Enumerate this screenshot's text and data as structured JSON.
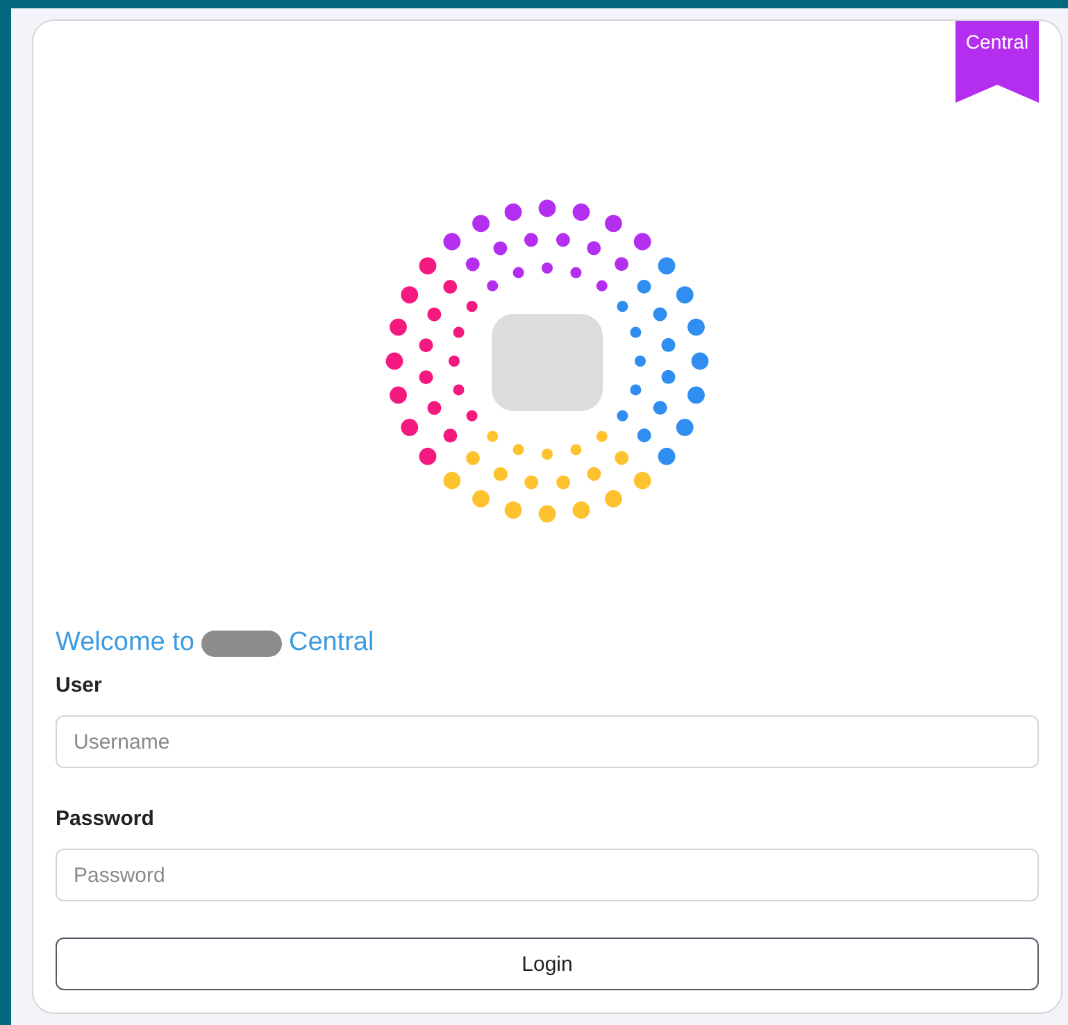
{
  "ribbon": {
    "label": "Central"
  },
  "welcome": {
    "prefix": "Welcome to",
    "suffix": "Central"
  },
  "fields": [
    {
      "label": "User",
      "placeholder": "Username"
    },
    {
      "label": "Password",
      "placeholder": "Password"
    }
  ],
  "buttons": [
    "Login"
  ]
}
